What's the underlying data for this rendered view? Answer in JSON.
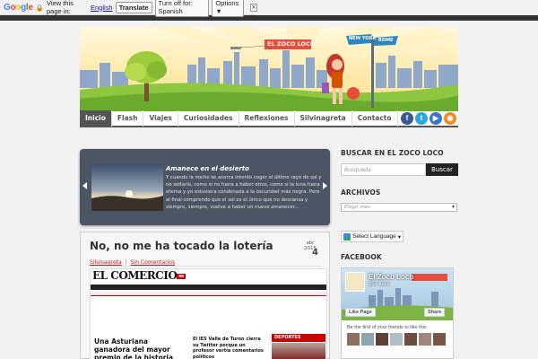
{
  "translate_bar": {
    "logo": [
      "G",
      "o",
      "o",
      "g",
      "l",
      "e"
    ],
    "prompt": "View this page in:",
    "language": "English",
    "translate_label": "Translate",
    "turn_off_label": "Turn off for: Spanish",
    "options_label": "Options ▼",
    "close_label": "×"
  },
  "header": {
    "banner_text": "EL ZOCO LOCO",
    "signs": [
      "NEW YORK",
      "ROME"
    ]
  },
  "nav": {
    "items": [
      "Inicio",
      "Flash",
      "Viajes",
      "Curiosidades",
      "Reflexiones",
      "Silvinagreta",
      "Contacto"
    ],
    "social": [
      {
        "icon": "facebook-icon",
        "glyph": "f",
        "color": "#3b5998"
      },
      {
        "icon": "twitter-icon",
        "glyph": "t",
        "color": "#2aa9e0"
      },
      {
        "icon": "youtube-icon",
        "glyph": "▶",
        "color": "#3b78c4"
      },
      {
        "icon": "rss-icon",
        "glyph": "◉",
        "color": "#f08a24"
      }
    ]
  },
  "slider": {
    "title": "Amanece en el desierto",
    "text": "Y cuando la noche se acerca intento coger el último rayo de sol y no soltarlo, como si no fuera a haber otros, como si la luna fuera eterna y yo estuviera condenada a la oscuridad más negra. Pero al final comprendo que el sol es el único que no descansa y siempre, siempre, vuelve a haber un nuevo amanecer..."
  },
  "post": {
    "title": "No, no me ha tocado la lotería",
    "date_month": "abr 2016",
    "date_day": "4",
    "author": "Silvinagreta",
    "separator": "|",
    "comments": "Sin Comentarios",
    "clipping": {
      "logo": "EL COMERCIO",
      "logo_badge": "es",
      "headline_main": "Una Asturiana ganadora del mayor premio de la historia del Euromillón",
      "headline_side": "El IES Valle de Turón cierra su Twitter porque un profesor vertía comentarios políticos",
      "section": "DEPORTES"
    }
  },
  "sidebar": {
    "search_heading": "BUSCAR EN EL ZOCO LOCO",
    "search_placeholder": "Busqueda",
    "search_button": "Buscar",
    "archive_heading": "ARCHIVOS",
    "archive_placeholder": "Elegir mes",
    "language_label": "Select Language",
    "facebook_heading": "FACEBOOK",
    "fb": {
      "name": "El Zoco Loco",
      "likes": "257 likes",
      "like_button": "Like Page",
      "share_button": "Share",
      "friends_text": "Be the first of your friends to like this"
    }
  }
}
